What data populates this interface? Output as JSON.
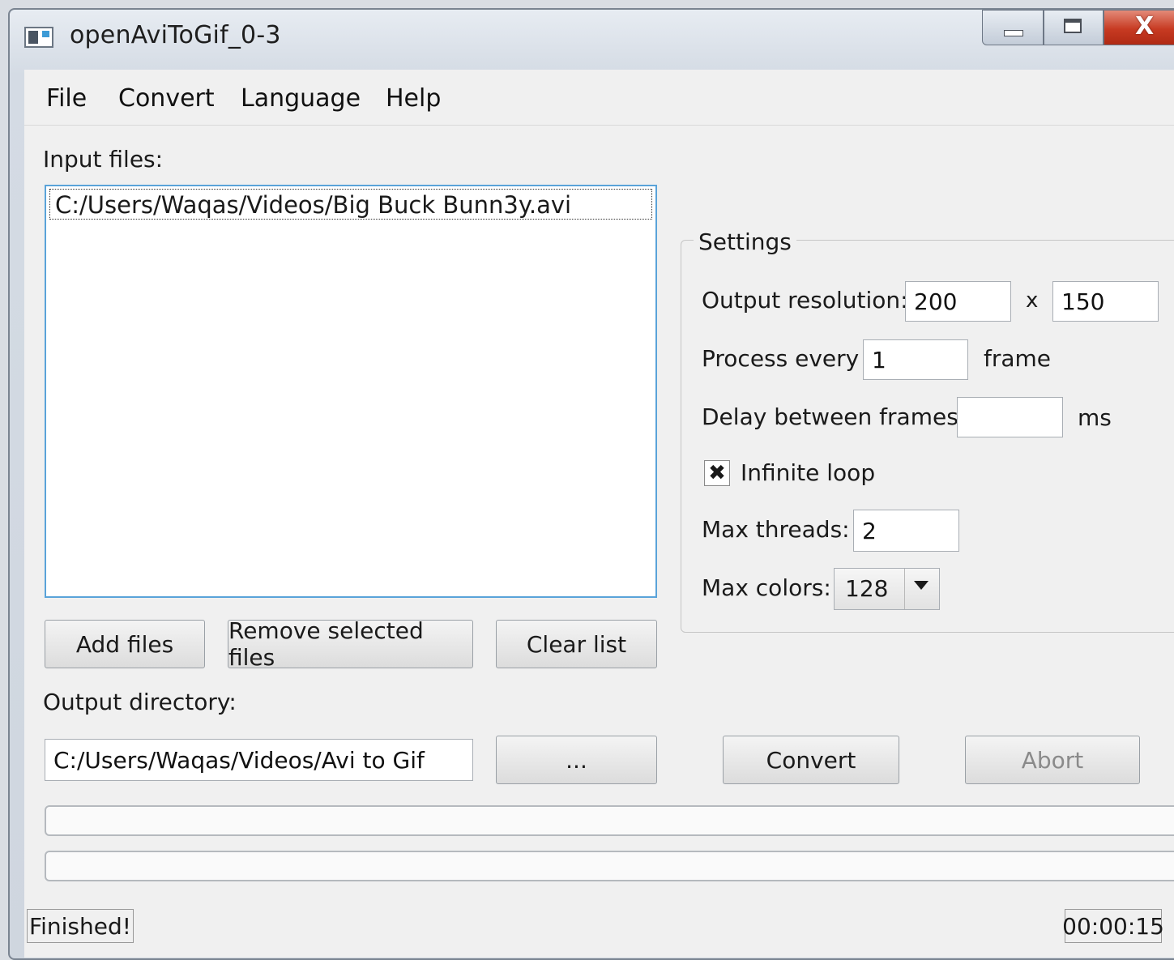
{
  "window": {
    "title": "openAviToGif_0-3",
    "close_glyph": "X"
  },
  "menu": {
    "file": "File",
    "convert": "Convert",
    "language": "Language",
    "help": "Help"
  },
  "input": {
    "label": "Input files:",
    "files": [
      "C:/Users/Waqas/Videos/Big Buck Bunn3y.avi"
    ]
  },
  "buttons": {
    "add_files": "Add files",
    "remove_selected": "Remove selected files",
    "clear_list": "Clear list",
    "browse": "...",
    "convert": "Convert",
    "abort": "Abort"
  },
  "output": {
    "label": "Output directory:",
    "path": "C:/Users/Waqas/Videos/Avi to Gif"
  },
  "settings": {
    "title": "Settings",
    "resolution_label": "Output resolution:",
    "width": "200",
    "separator": "x",
    "height": "150",
    "process_label": "Process every",
    "process_value": "1",
    "frame_label": "frame",
    "delay_label": "Delay between frames:",
    "delay_value": "",
    "ms_label": "ms",
    "loop_label": "Infinite loop",
    "loop_checked_glyph": "✖",
    "threads_label": "Max threads:",
    "threads_value": "2",
    "colors_label": "Max colors:",
    "colors_value": "128"
  },
  "status": {
    "text": "Finished!",
    "time": "00:00:15"
  },
  "icons": [
    "app-icon",
    "minimize-icon",
    "maximize-icon",
    "close-icon",
    "dropdown-arrow-icon",
    "checkbox-checked-icon"
  ]
}
